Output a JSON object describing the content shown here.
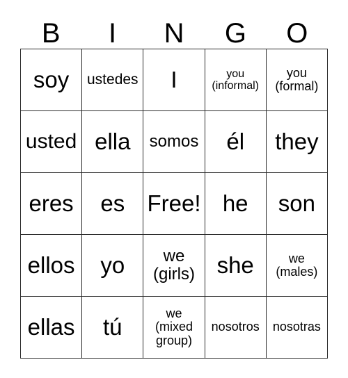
{
  "card": {
    "title_letters": [
      "B",
      "I",
      "N",
      "G",
      "O"
    ],
    "columns": [
      "B",
      "I",
      "N",
      "G",
      "O"
    ],
    "free_space_label": "Free!",
    "border_color": "#2b2b2b",
    "background_color": "#ffffff",
    "text_color": "#000000",
    "rows": [
      [
        {
          "text": "soy",
          "size": "xl"
        },
        {
          "text": "ustedes",
          "size": "sm"
        },
        {
          "text": "I",
          "size": "xl"
        },
        {
          "text": "you\n(informal)",
          "size": "xxs"
        },
        {
          "text": "you\n(formal)",
          "size": "xs"
        }
      ],
      [
        {
          "text": "usted",
          "size": "lg"
        },
        {
          "text": "ella",
          "size": "xl"
        },
        {
          "text": "somos",
          "size": "md"
        },
        {
          "text": "él",
          "size": "xl"
        },
        {
          "text": "they",
          "size": "xl"
        }
      ],
      [
        {
          "text": "eres",
          "size": "xl"
        },
        {
          "text": "es",
          "size": "xl"
        },
        {
          "text": "Free!",
          "size": "xl"
        },
        {
          "text": "he",
          "size": "xl"
        },
        {
          "text": "son",
          "size": "xl"
        }
      ],
      [
        {
          "text": "ellos",
          "size": "xl"
        },
        {
          "text": "yo",
          "size": "xl"
        },
        {
          "text": "we\n(girls)",
          "size": "md"
        },
        {
          "text": "she",
          "size": "xl"
        },
        {
          "text": "we\n(males)",
          "size": "xs"
        }
      ],
      [
        {
          "text": "ellas",
          "size": "xl"
        },
        {
          "text": "tú",
          "size": "xl"
        },
        {
          "text": "we\n(mixed\ngroup)",
          "size": "xs"
        },
        {
          "text": "nosotros",
          "size": "xs"
        },
        {
          "text": "nosotras",
          "size": "xs"
        }
      ]
    ]
  }
}
